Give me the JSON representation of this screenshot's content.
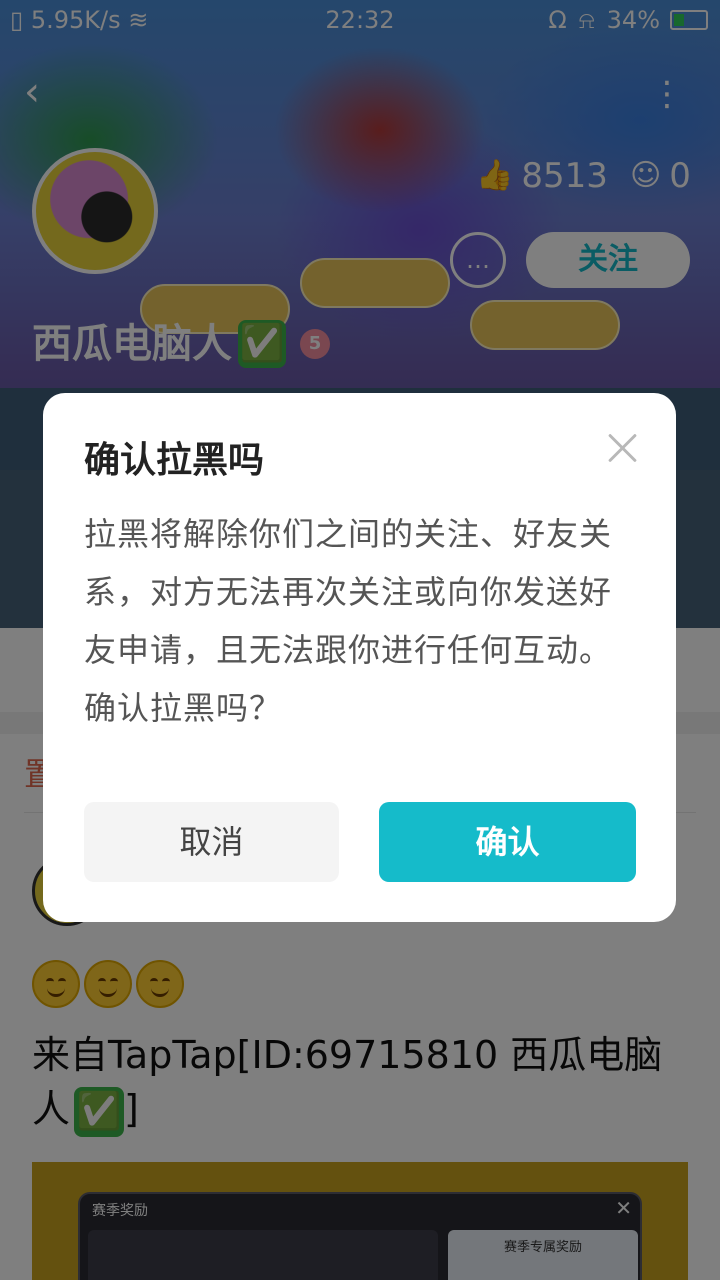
{
  "status_bar": {
    "net_speed": "5.95K/s",
    "time": "22:32",
    "battery_percent": "34%",
    "battery_level": 0.34,
    "icons": [
      "sim-icon",
      "wifi-icon",
      "headset-icon",
      "mute-bell-icon",
      "battery-icon"
    ]
  },
  "profile": {
    "likes": "8513",
    "fans": "0",
    "follow_label": "关注",
    "username": "西瓜电脑人",
    "verified_emoji": "✅",
    "level": "5"
  },
  "feed": {
    "pinned_label": "置",
    "post_emojis": [
      "😊",
      "😊",
      "😊"
    ],
    "post_text": "来自TapTap[ID:69715810 西瓜电脑人",
    "post_text_verified": "✅",
    "post_text_tail": "]",
    "image_panel_title": "赛季奖励",
    "image_panel_close": "✕",
    "image_panel_right_title": "赛季专属奖励"
  },
  "dialog": {
    "title": "确认拉黑吗",
    "body": "拉黑将解除你们之间的关注、好友关系，对方无法再次关注或向你发送好友申请，且无法跟你进行任何互动。确认拉黑吗？",
    "cancel_label": "取消",
    "confirm_label": "确认"
  }
}
